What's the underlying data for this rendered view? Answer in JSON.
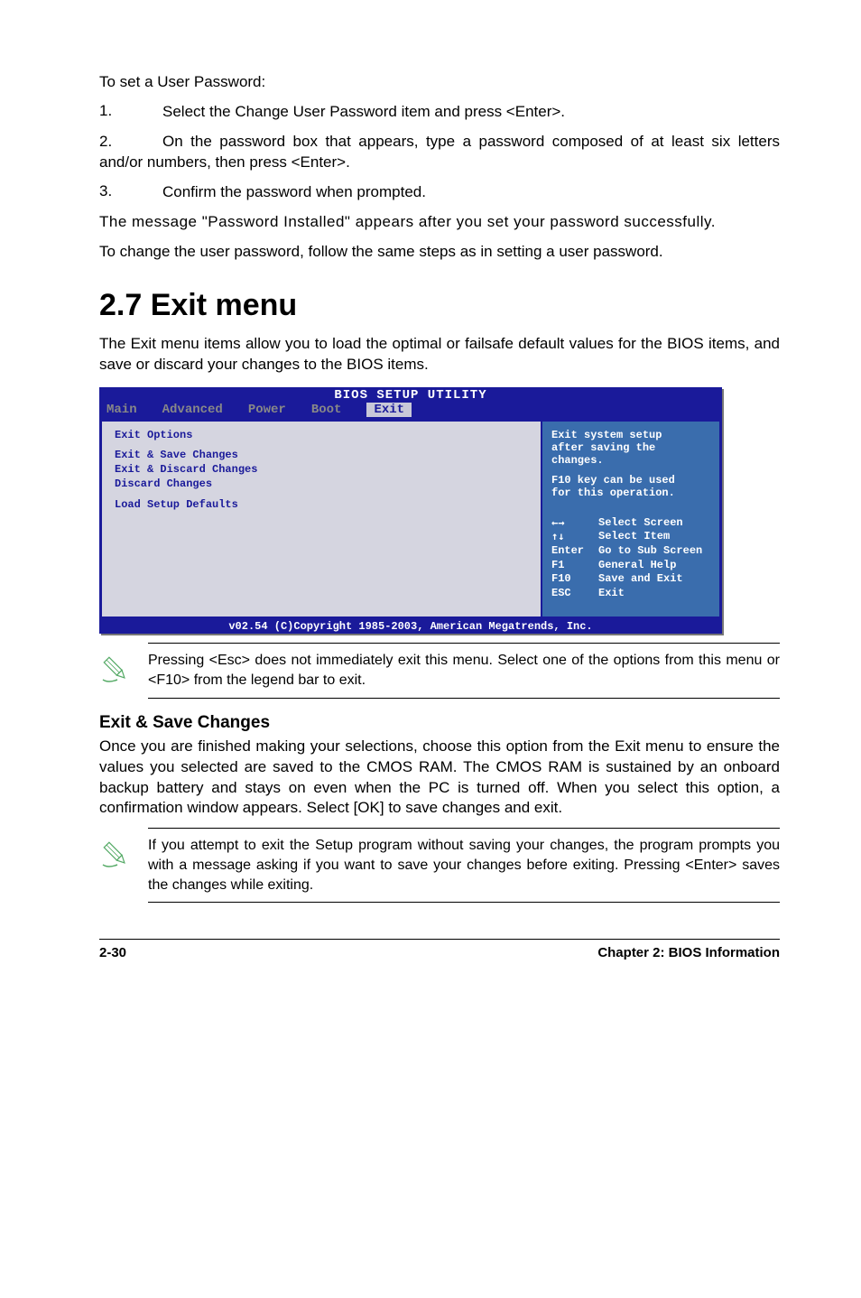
{
  "intro": {
    "heading": "To set a User Password:",
    "step1_num": "1.",
    "step1_text": "Select the Change User Password item and press <Enter>.",
    "step2_num": "2.",
    "step2_text": "On the password box that appears, type a password composed of at least six letters and/or numbers, then press <Enter>.",
    "step3_num": "3.",
    "step3_text": "Confirm the password when prompted.",
    "after1": "The message \"Password Installed\" appears after you set your password successfully.",
    "after2": "To change the user password, follow the same steps as in setting a user password."
  },
  "section": {
    "title": "2.7    Exit menu",
    "desc": "The Exit menu items allow you to load the optimal or failsafe default values for the BIOS items, and save or discard your changes to the BIOS items."
  },
  "bios": {
    "title": "BIOS SETUP UTILITY",
    "tabs": {
      "t1": "Main",
      "t2": "Advanced",
      "t3": "Power",
      "t4": "Boot",
      "t5": "Exit"
    },
    "left": {
      "heading": "Exit Options",
      "i1": "Exit & Save Changes",
      "i2": "Exit & Discard Changes",
      "i3": "Discard Changes",
      "i4": "Load Setup Defaults"
    },
    "right": {
      "l1": "Exit system setup",
      "l2": "after saving the",
      "l3": "changes.",
      "l4": "F10 key can be used",
      "l5": "for this operation.",
      "h1k": "←→",
      "h1v": "Select Screen",
      "h2k": "↑↓",
      "h2v": "Select Item",
      "h3k": "Enter",
      "h3v": "Go to Sub Screen",
      "h4k": "F1",
      "h4v": "General Help",
      "h5k": "F10",
      "h5v": "Save and Exit",
      "h6k": "ESC",
      "h6v": "Exit"
    },
    "footer": "v02.54 (C)Copyright 1985-2003, American Megatrends, Inc."
  },
  "note1": "Pressing <Esc> does not immediately exit this menu. Select one of the options from this menu or <F10> from the legend bar to exit.",
  "subhead": "Exit & Save Changes",
  "subdesc": "Once you are finished making your selections, choose this option from the Exit menu to ensure the values you selected are saved to the CMOS RAM. The CMOS RAM is sustained by an onboard backup battery and stays on even when the PC is turned off. When you select this option, a confirmation window appears. Select [OK] to save changes and exit.",
  "note2": "If you attempt to exit the Setup program without saving your changes, the program prompts you with a message asking if you want to save your changes before exiting. Pressing <Enter> saves the changes while exiting.",
  "footer": {
    "left": "2-30",
    "right": "Chapter 2: BIOS Information"
  }
}
